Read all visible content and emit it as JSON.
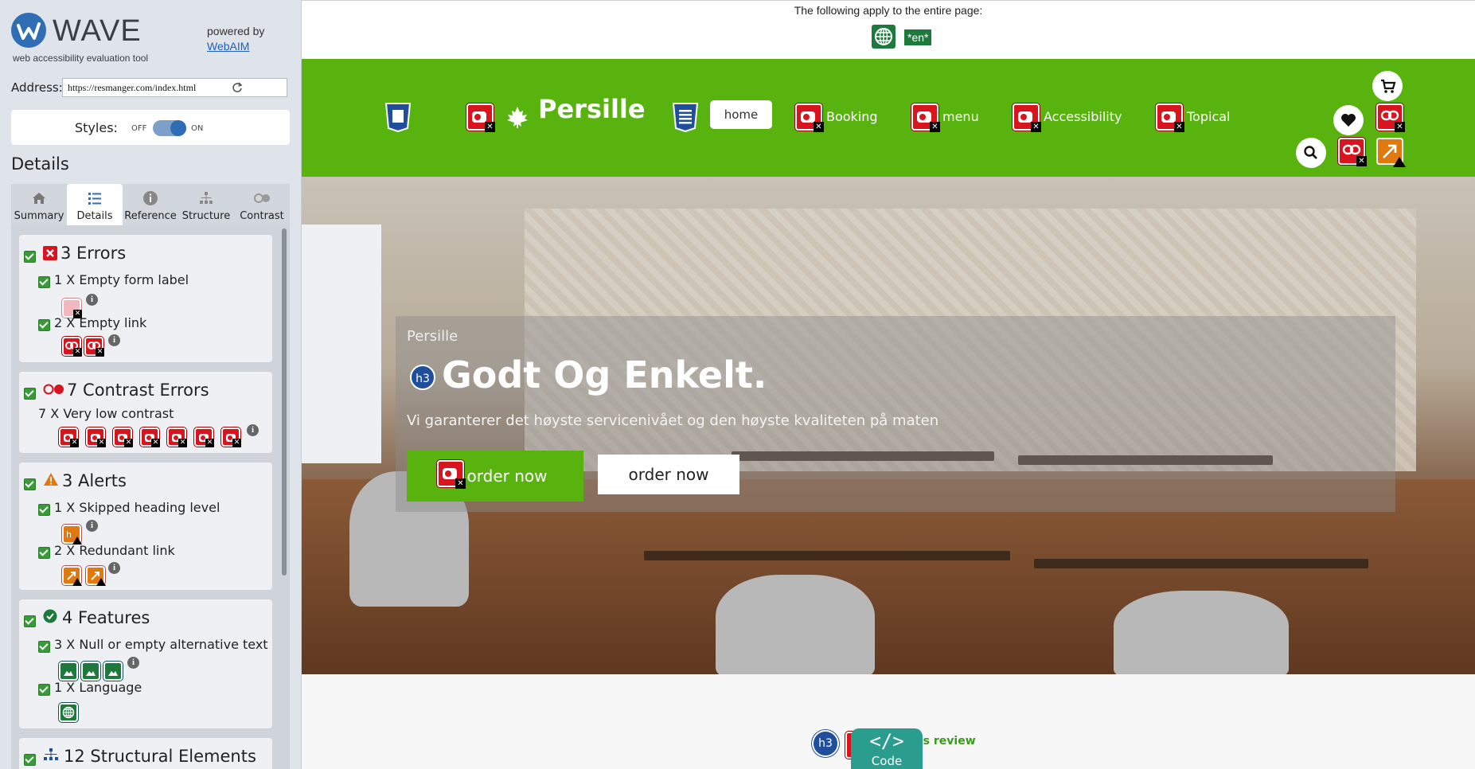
{
  "wave": {
    "brand": "WAVE",
    "tagline": "web accessibility evaluation tool",
    "powered_by": "powered by",
    "webaim": "WebAIM",
    "address_label": "Address:",
    "address_value": "https://resmanger.com/index.html",
    "styles_label": "Styles:",
    "styles_off": "OFF",
    "styles_on": "ON",
    "details_title": "Details",
    "tabs": [
      {
        "label": "Summary",
        "icon": "home-icon"
      },
      {
        "label": "Details",
        "icon": "list-icon"
      },
      {
        "label": "Reference",
        "icon": "info-icon"
      },
      {
        "label": "Structure",
        "icon": "hierarchy-icon"
      },
      {
        "label": "Contrast",
        "icon": "contrast-icon"
      }
    ],
    "active_tab": "Details",
    "sections": {
      "errors": {
        "title": "3 Errors",
        "items": [
          {
            "text": "1 X Empty form label",
            "icon_count": 1
          },
          {
            "text": "2 X Empty link",
            "icon_count": 2
          }
        ]
      },
      "contrast": {
        "title": "7 Contrast Errors",
        "items": [
          {
            "text": "7 X Very low contrast",
            "icon_count": 7
          }
        ]
      },
      "alerts": {
        "title": "3 Alerts",
        "items": [
          {
            "text": "1 X Skipped heading level",
            "icon_count": 1
          },
          {
            "text": "2 X Redundant link",
            "icon_count": 2
          }
        ]
      },
      "features": {
        "title": "4 Features",
        "items": [
          {
            "text": "3 X Null or empty alternative text",
            "icon_count": 3
          },
          {
            "text": "1 X Language",
            "icon_count": 1
          }
        ]
      },
      "structural": {
        "title": "12 Structural Elements"
      }
    },
    "colors": {
      "error": "#d8141f",
      "alert": "#e07a10",
      "feature": "#1d7a3c",
      "structure": "#1f4f9c"
    }
  },
  "page": {
    "top_note": "The following apply to the entire page:",
    "lang_badge": "*en*",
    "nav": {
      "brand": "Persille",
      "home": "home",
      "links": [
        "Booking",
        "menu",
        "Accessibility",
        "Topical"
      ]
    },
    "hero": {
      "kicker": "Persille",
      "heading_badge": "h3",
      "title": "Godt Og Enkelt.",
      "subtitle": "Vi garanterer det høyste servicenivået og den høyste kvaliteten på maten",
      "primary_button": "order now",
      "secondary_button": "order now"
    },
    "below": {
      "heading_badge": "h3",
      "link_text": "er's review"
    },
    "code_button": {
      "glyph": "</>",
      "label": "Code"
    },
    "brand_color": "#58b30f"
  }
}
